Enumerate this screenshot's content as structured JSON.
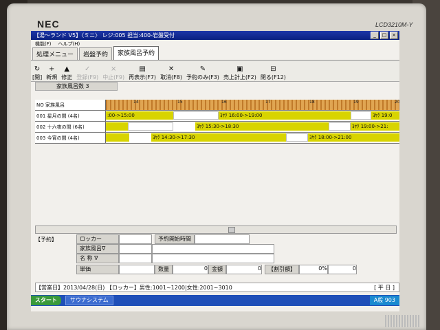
{
  "monitor": {
    "brand": "NEC",
    "model": "LCD3210M-Y"
  },
  "window": {
    "title": "【湯～ランド V5】〈ミニ〉 レジ:005 担当:400-岩盤受付",
    "min": "_",
    "max": "□",
    "close": "×"
  },
  "menu": {
    "items": [
      "機能(F)",
      "ヘルプ(H)"
    ]
  },
  "tabs": [
    "処理メニュー",
    "岩盤予約",
    "家族風呂予約"
  ],
  "toolbar": {
    "buttons": [
      {
        "icon": "↻",
        "label": "[開]"
      },
      {
        "icon": "+",
        "label": "新規"
      },
      {
        "icon": "▲",
        "label": "修正"
      },
      {
        "icon": "✓",
        "label": "登録(F9)"
      },
      {
        "icon": "×",
        "label": "中止(F9)"
      },
      {
        "icon": "▤",
        "label": "再表示(F7)"
      },
      {
        "icon": "✕",
        "label": "取消(F8)"
      },
      {
        "icon": "✎",
        "label": "予約のみ(F3)"
      },
      {
        "icon": "▣",
        "label": "売上計上(F2)"
      },
      {
        "icon": "⊟",
        "label": "閉る(F12)"
      }
    ]
  },
  "count_label": "家族風呂数 3",
  "grid": {
    "header_label": "NO 家族風呂",
    "hour_ticks": [
      "14",
      "15",
      "16",
      "17",
      "18",
      "19",
      "20"
    ],
    "rows": [
      {
        "name": "001 星月の間 (4名)",
        "segments": [
          {
            "label": ":00->15:00",
            "cls": "y"
          },
          {
            "label": "ﾖﾔｸ 16:00->19:00",
            "cls": "y"
          },
          {
            "label": "ﾖﾔｸ 19:0",
            "cls": "y"
          }
        ]
      },
      {
        "name": "002 十六夜の間 (6名)",
        "segments": [
          {
            "label": "",
            "cls": "y"
          },
          {
            "label": "ﾖﾔｸ 15:30->18:30",
            "cls": "y"
          },
          {
            "label": "ﾖﾔｸ 19:00->21:",
            "cls": "y"
          }
        ]
      },
      {
        "name": "003 今宵の間 (4名)",
        "segments": [
          {
            "label": "",
            "cls": "y"
          },
          {
            "label": "ﾖﾔｸ 14:30->17:30",
            "cls": "y"
          },
          {
            "label": "ﾖﾔｸ 18:00->21:00",
            "cls": "y"
          }
        ]
      }
    ]
  },
  "form": {
    "section": "【予約】",
    "locker": "ロッカー",
    "start_time": "予約開始時間",
    "family_bath": "家族風呂∇",
    "name": "名 称 ∇",
    "unit_price": "単価",
    "quantity": "数量",
    "quantity_value": "0",
    "amount": "金額",
    "amount_value": "0",
    "discount": "【割引額】",
    "discount_pct": "0%",
    "discount_value": "0"
  },
  "status": {
    "text": "【営業日】2013/04/28(日) 【ロッカー】男性:1001~1200|女性:2001~3010",
    "day": "[ 平 日 ]"
  },
  "taskbar": {
    "start": "スタート",
    "app": "サウナシステム",
    "tray": "A般 903"
  }
}
